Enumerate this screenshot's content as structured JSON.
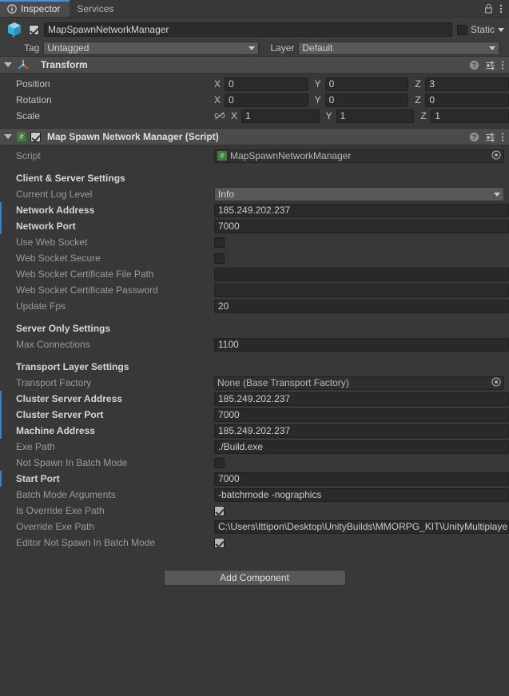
{
  "theme": {
    "accent": "#4a90d9",
    "panel_bg": "#383838",
    "header_bg": "#4b4b4b",
    "field_bg": "#2a2a2a",
    "override_bar": "#3b7fc4",
    "script_icon_green": "#3f7a3f"
  },
  "tabs": {
    "items": [
      {
        "label": "Inspector",
        "icon": "info-icon",
        "active": true
      },
      {
        "label": "Services",
        "icon": "",
        "active": false
      }
    ],
    "right_icons": [
      {
        "name": "lock-icon"
      },
      {
        "name": "kebab-menu-icon"
      }
    ]
  },
  "gameobject": {
    "icon": "cube-icon",
    "enabled": true,
    "name": "MapSpawnNetworkManager",
    "static_label": "Static",
    "static_checked": false,
    "tag_label": "Tag",
    "tag_value": "Untagged",
    "layer_label": "Layer",
    "layer_value": "Default"
  },
  "transform": {
    "title": "Transform",
    "icon": "transform-axis-icon",
    "expanded": true,
    "header_icons": [
      "help-icon",
      "preset-icon",
      "kebab-menu-icon"
    ],
    "rows": [
      {
        "label": "Position",
        "x": "0",
        "y": "0",
        "z": "3",
        "constrain_icon": false
      },
      {
        "label": "Rotation",
        "x": "0",
        "y": "0",
        "z": "0",
        "constrain_icon": false
      },
      {
        "label": "Scale",
        "x": "1",
        "y": "1",
        "z": "1",
        "constrain_icon": true
      }
    ],
    "axis_labels": {
      "x": "X",
      "y": "Y",
      "z": "Z"
    }
  },
  "script_component": {
    "title": "Map Spawn Network Manager (Script)",
    "icon": "csharp-script-icon",
    "enabled": true,
    "expanded": true,
    "header_icons": [
      "help-icon",
      "preset-icon",
      "kebab-menu-icon"
    ],
    "script_row": {
      "label": "Script",
      "value": "MapSpawnNetworkManager",
      "picker_icon": "object-picker-icon"
    },
    "sections": [
      {
        "title": "Client & Server Settings",
        "fields": [
          {
            "label": "Current Log Level",
            "type": "popup",
            "value": "Info",
            "bold": false,
            "override": false
          },
          {
            "label": "Network Address",
            "type": "text",
            "value": "185.249.202.237",
            "bold": true,
            "override": true
          },
          {
            "label": "Network Port",
            "type": "text",
            "value": "7000",
            "bold": true,
            "override": true
          },
          {
            "label": "Use Web Socket",
            "type": "checkbox",
            "checked": false,
            "bold": false,
            "override": false
          },
          {
            "label": "Web Socket Secure",
            "type": "checkbox",
            "checked": false,
            "bold": false,
            "override": false
          },
          {
            "label": "Web Socket Certificate File Path",
            "type": "text",
            "value": "",
            "bold": false,
            "override": false
          },
          {
            "label": "Web Socket Certificate Password",
            "type": "text",
            "value": "",
            "bold": false,
            "override": false
          },
          {
            "label": "Update Fps",
            "type": "text",
            "value": "20",
            "bold": false,
            "override": false
          }
        ]
      },
      {
        "title": "Server Only Settings",
        "fields": [
          {
            "label": "Max Connections",
            "type": "text",
            "value": "1100",
            "bold": false,
            "override": false
          }
        ]
      },
      {
        "title": "Transport Layer Settings",
        "fields": [
          {
            "label": "Transport Factory",
            "type": "object",
            "value": "None (Base Transport Factory)",
            "bold": false,
            "override": false
          },
          {
            "label": "Cluster Server Address",
            "type": "text",
            "value": "185.249.202.237",
            "bold": true,
            "override": true
          },
          {
            "label": "Cluster Server Port",
            "type": "text",
            "value": "7000",
            "bold": true,
            "override": true
          },
          {
            "label": "Machine Address",
            "type": "text",
            "value": "185.249.202.237",
            "bold": true,
            "override": true
          },
          {
            "label": "Exe Path",
            "type": "text",
            "value": "./Build.exe",
            "bold": false,
            "override": false
          },
          {
            "label": "Not Spawn In Batch Mode",
            "type": "checkbox",
            "checked": false,
            "bold": false,
            "override": false
          },
          {
            "label": "Start Port",
            "type": "text",
            "value": "7000",
            "bold": true,
            "override": true
          },
          {
            "label": "Batch Mode Arguments",
            "type": "text",
            "value": "-batchmode -nographics",
            "bold": false,
            "override": false
          },
          {
            "label": "Is Override Exe Path",
            "type": "checkbox",
            "checked": true,
            "bold": false,
            "override": false
          },
          {
            "label": "Override Exe Path",
            "type": "text",
            "value": "C:\\Users\\Ittipon\\Desktop\\UnityBuilds\\MMORPG_KIT\\UnityMultiplayerARPG",
            "bold": false,
            "override": false
          },
          {
            "label": "Editor Not Spawn In Batch Mode",
            "type": "checkbox",
            "checked": true,
            "bold": false,
            "override": false
          }
        ]
      }
    ]
  },
  "add_component": {
    "label": "Add Component"
  }
}
